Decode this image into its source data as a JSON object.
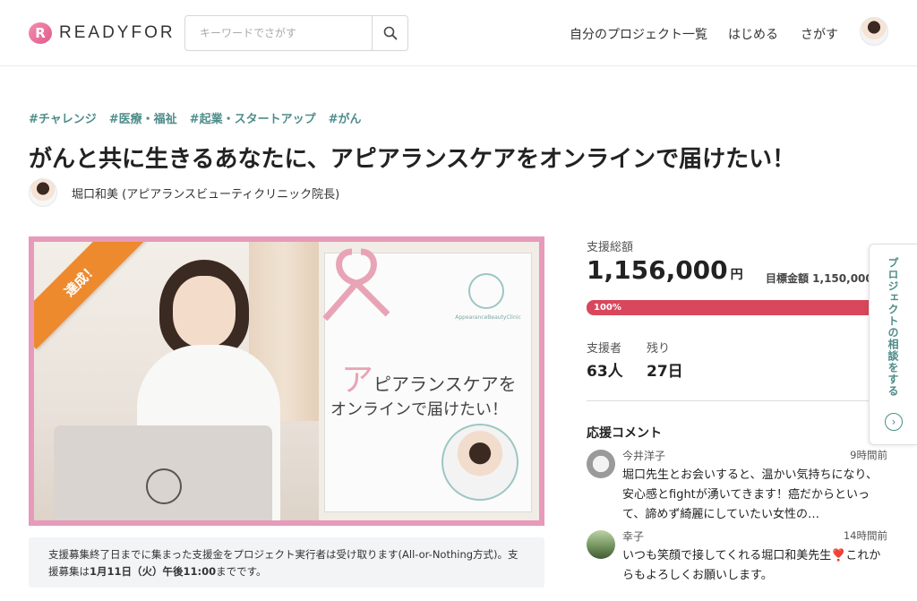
{
  "header": {
    "logo_mark": "R",
    "logo_text": "READYFOR",
    "search_placeholder": "キーワードでさがす",
    "nav": [
      "自分のプロジェクト一覧",
      "はじめる",
      "さがす"
    ]
  },
  "project": {
    "tags": [
      "#チャレンジ",
      "#医療・福祉",
      "#起業・スタートアップ",
      "#がん"
    ],
    "title": "がんと共に生きるあなたに、アピアランスケアをオンラインで届けたい！",
    "owner": "堀口和美 (アピアランスビューティクリニック院長)",
    "badge": "達成！",
    "image_card": {
      "clinic_name": "AppearanceBeautyClinic",
      "line1_first": "ア",
      "line1_rest": "ピアランスケアを",
      "line2": "オンラインで届けたい！"
    },
    "notice_text": "支援募集終了日までに集まった支援金をプロジェクト実行者は受け取ります(All-or-Nothing方式)。支援募集は",
    "notice_bold": "1月11日（火）午後11:00",
    "notice_tail": "までです。"
  },
  "stats": {
    "total_label": "支援総額",
    "total_value": "1,156,000",
    "currency": "円",
    "goal_label": "目標金額 1,150,000",
    "progress_text": "100%",
    "progress_value": 100,
    "supporters_label": "支援者",
    "supporters_value": "63人",
    "remaining_label": "残り",
    "remaining_value": "27日"
  },
  "comments": {
    "heading": "応援コメント",
    "items": [
      {
        "name": "今井洋子",
        "time": "9時間前",
        "text": "堀口先生とお会いすると、温かい気持ちになり、安心感とfightが湧いてきます！癌だからといって、諦めず綺麗にしていたい女性の…"
      },
      {
        "name": "幸子",
        "time": "14時間前",
        "text": "いつも笑顔で接してくれる堀口和美先生❣️これからもよろしくお願いします。"
      }
    ]
  },
  "side_tab": {
    "label": "プロジェクトの相談をする",
    "arrow": "›"
  },
  "colors": {
    "accent": "#4e8d8a",
    "progress": "#d8475c",
    "badge": "#ee8a2e",
    "frame": "#e79ab9"
  }
}
